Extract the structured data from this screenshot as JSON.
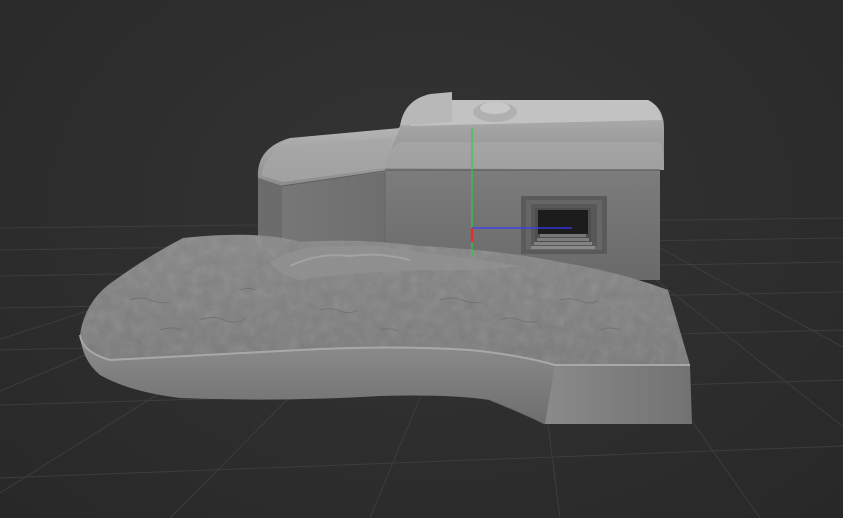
{
  "viewport": {
    "background_color": "#2e2e2e",
    "grid_color": "#3d3d3d",
    "model_color": "#8a8a8a",
    "axes": {
      "x_axis_color": "#3a3aff",
      "y_axis_color": "#2ecc40",
      "z_axis_color": "#e03030"
    },
    "gizmo_icon": "xyz-axis-gizmo-icon"
  }
}
